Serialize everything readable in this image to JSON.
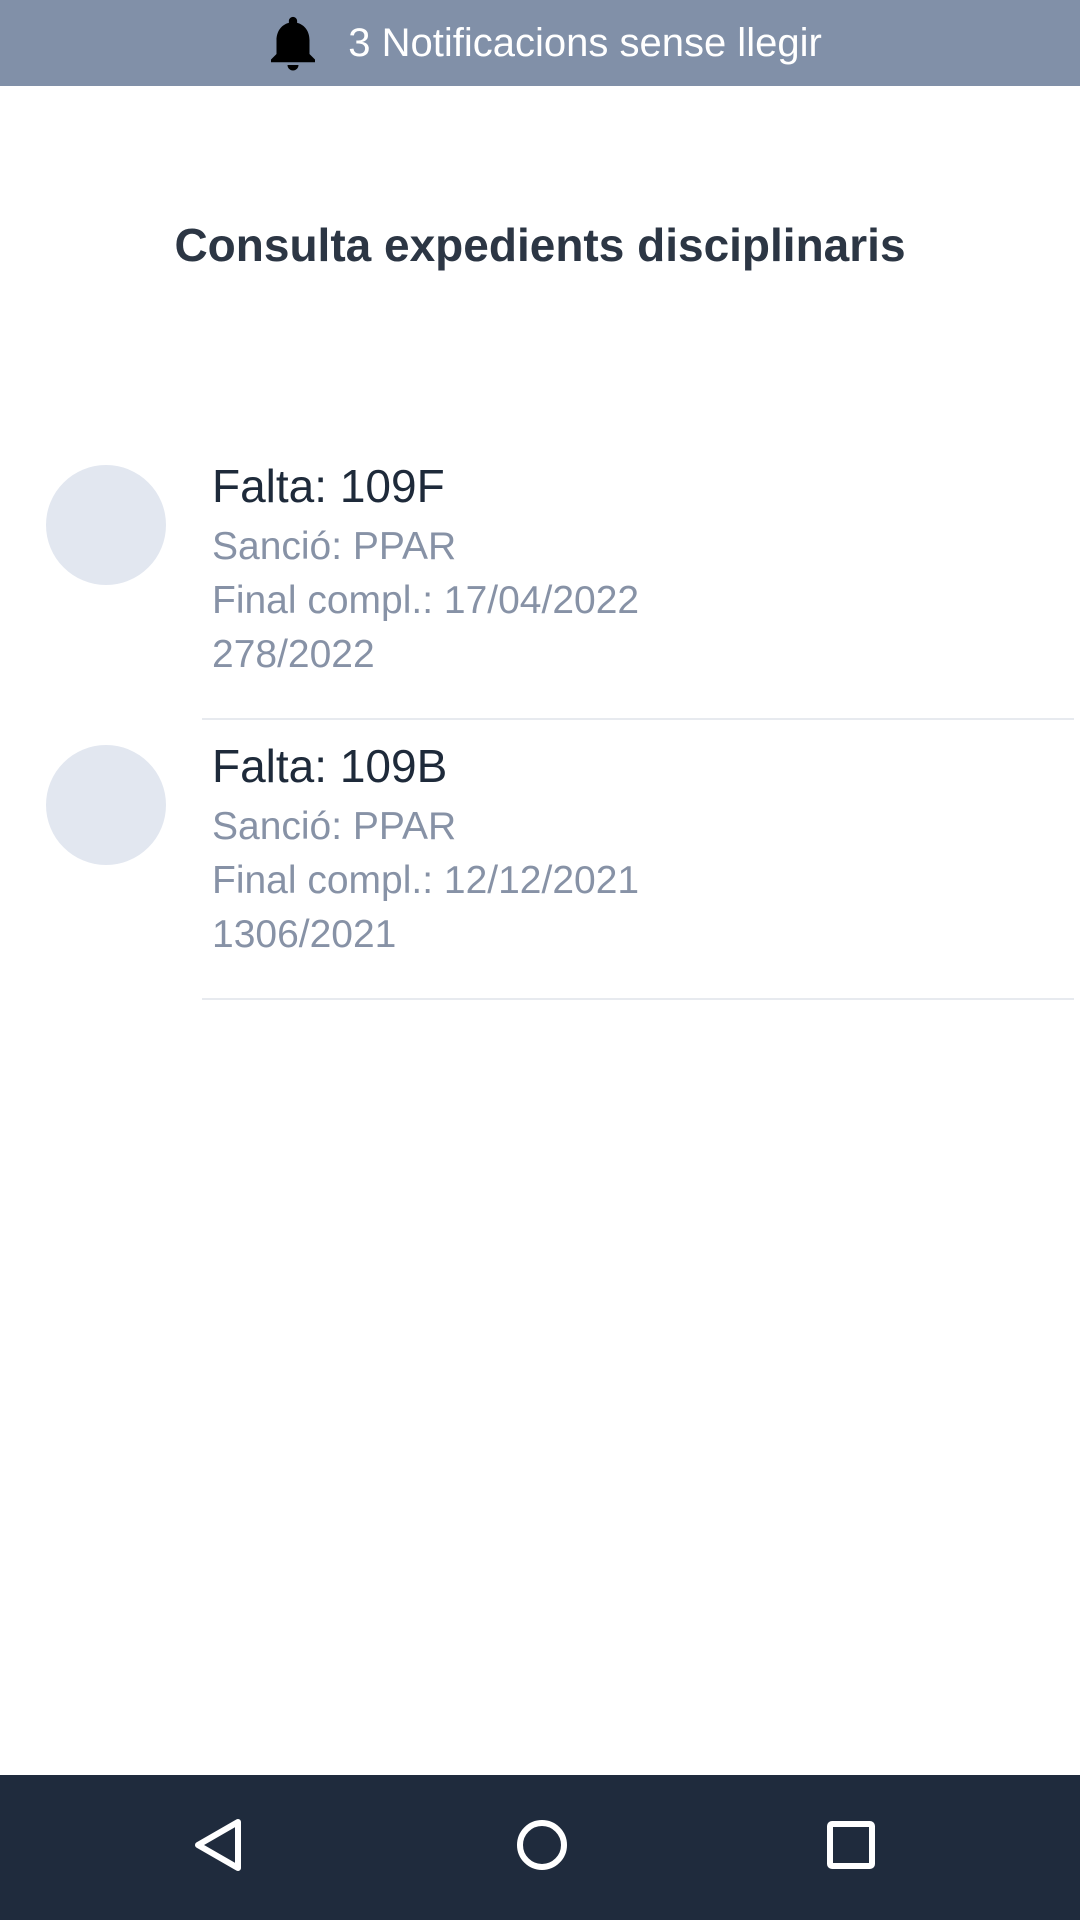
{
  "notification_bar": {
    "icon": "bell-icon",
    "text": "3 Notificacions sense llegir"
  },
  "page": {
    "title": "Consulta expedients disciplinaris"
  },
  "items": [
    {
      "title": "Falta: 109F",
      "sanction": "Sanció: PPAR",
      "final": "Final compl.: 17/04/2022",
      "reference": "278/2022"
    },
    {
      "title": "Falta: 109B",
      "sanction": "Sanció: PPAR",
      "final": "Final compl.: 12/12/2021",
      "reference": "1306/2021"
    }
  ],
  "nav_bar": {
    "back_icon": "back-triangle-icon",
    "home_icon": "home-circle-icon",
    "recents_icon": "recents-square-icon"
  },
  "colors": {
    "notification_bar": "#8190a8",
    "nav_bar": "#1f2b3d",
    "title": "#2c3644",
    "avatar": "#e2e7f0",
    "secondary_text": "#8792a6"
  }
}
